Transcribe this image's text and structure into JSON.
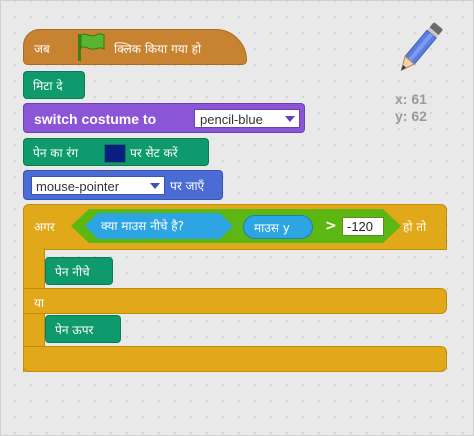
{
  "sprite": {
    "icon": "pencil-icon",
    "x_label": "x:",
    "x_value": "61",
    "y_label": "y:",
    "y_value": "62"
  },
  "script": {
    "hat": {
      "pre": "जब",
      "icon": "green-flag-icon",
      "post": "क्लिक किया गया हो"
    },
    "clear": {
      "label": "मिटा दे"
    },
    "switch_costume": {
      "label": "switch costume to",
      "value": "pencil-blue"
    },
    "set_pen_color": {
      "pre": "पेन का रंग",
      "post": "पर सेट करें",
      "color": "#0a1f80"
    },
    "go_to": {
      "value": "mouse-pointer",
      "post": "पर जाएँ"
    },
    "if_else": {
      "if_label": "अगर",
      "then_label": "हो तो",
      "else_label": "या",
      "condition": {
        "mouse_down": "क्या माउस नीचे है?",
        "mouse_y": "माउस y",
        "operator": ">",
        "value": "-120"
      },
      "then_block": "पेन नीचे",
      "else_block": "पेन ऊपर"
    }
  },
  "colors": {
    "events": "#c88330",
    "pen": "#0e9a6c",
    "looks": "#8a55d7",
    "motion": "#4a6cd4",
    "control": "#e1a91a",
    "sensing": "#2ca5e2",
    "operators": "#5cb712"
  }
}
